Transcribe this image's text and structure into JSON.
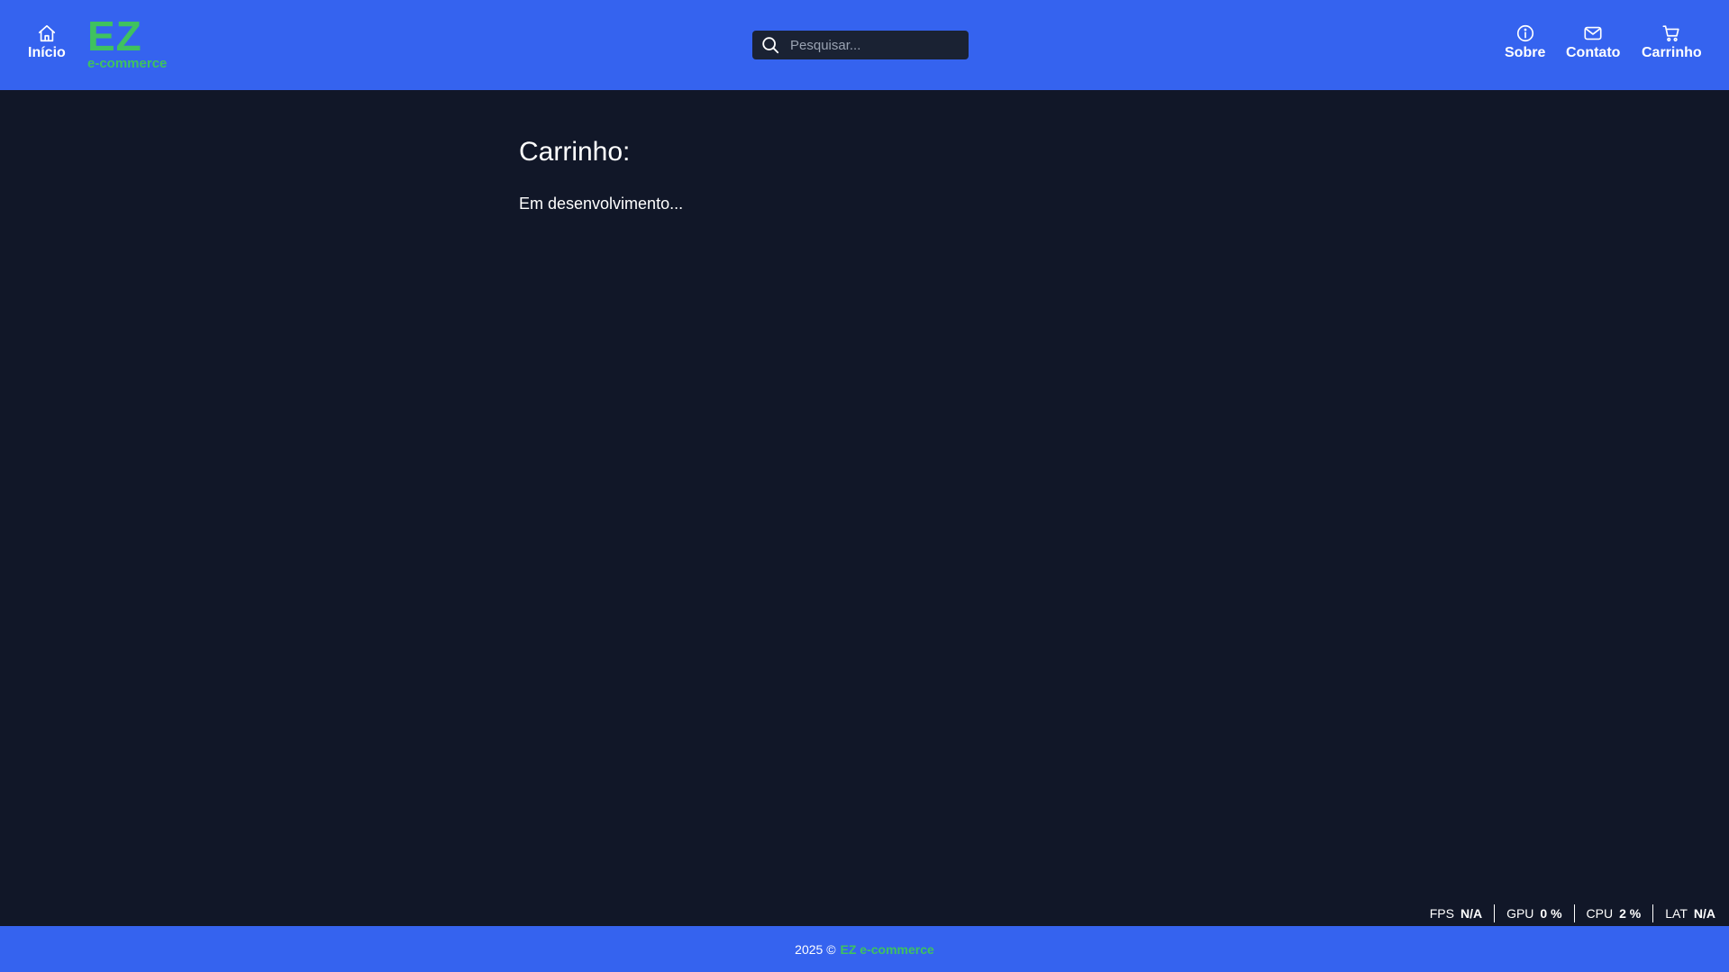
{
  "header": {
    "home_label": "Início",
    "logo_main": "EZ",
    "logo_sub": "e-commerce",
    "search_placeholder": "Pesquisar...",
    "nav": {
      "about_label": "Sobre",
      "contact_label": "Contato",
      "cart_label": "Carrinho"
    }
  },
  "main": {
    "title": "Carrinho:",
    "text": "Em desenvolvimento..."
  },
  "perf": {
    "fps_label": "FPS",
    "fps_value": "N/A",
    "gpu_label": "GPU",
    "gpu_value": "0 %",
    "cpu_label": "CPU",
    "cpu_value": "2 %",
    "lat_label": "LAT",
    "lat_value": "N/A"
  },
  "footer": {
    "copyright": "2025 ©",
    "brand": "EZ e-commerce"
  },
  "colors": {
    "header_bg": "#3563ef",
    "page_bg": "#111728",
    "brand_green": "#3fc25f",
    "search_bg": "#1a2233"
  },
  "icons": {
    "home": "home-icon",
    "search": "search-icon",
    "about": "info-icon",
    "contact": "mail-icon",
    "cart": "cart-icon"
  }
}
